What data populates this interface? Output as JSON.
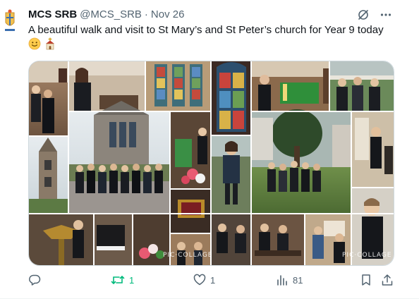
{
  "tweet": {
    "display_name": "MCS SRB",
    "handle": "@MCS_SRB",
    "separator": "·",
    "date": "Nov 26",
    "text": "A beautiful walk and visit to St Mary’s and St Peter’s church for Year 9 today",
    "emoji_1": "slightly-smiling-face",
    "emoji_2": "church"
  },
  "media": {
    "watermark_1": "PIC·COLLAGE",
    "watermark_2": "PIC·COLLAGE"
  },
  "actions": {
    "reply_count": "",
    "retweet_count": "1",
    "like_count": "1",
    "views_count": "81"
  },
  "colors": {
    "retweet_active": "#00ba7c",
    "muted": "#536471",
    "text": "#0f1419"
  }
}
